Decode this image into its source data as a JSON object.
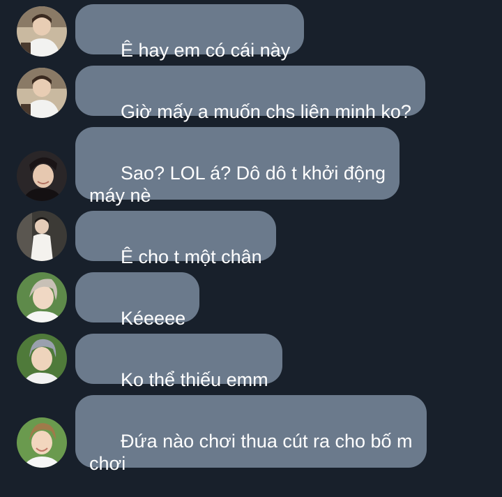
{
  "messages": [
    {
      "text": "Ê hay em có cái này",
      "avatar": "avatar-1"
    },
    {
      "text": "Giờ mấy a muốn chs liên minh ko?",
      "avatar": "avatar-1"
    },
    {
      "text": "Sao? LOL á? Dô dô t khởi động\nmáy nè",
      "avatar": "avatar-2"
    },
    {
      "text": "Ê cho t một chân",
      "avatar": "avatar-3"
    },
    {
      "text": "Kéeeee",
      "avatar": "avatar-4"
    },
    {
      "text": "Ko thể thiếu emm",
      "avatar": "avatar-5"
    },
    {
      "text": "Đứa nào chơi thua cút ra cho bố m\nchơi",
      "avatar": "avatar-6"
    }
  ],
  "colors": {
    "background": "#18202b",
    "bubble": "#6b7a8c",
    "text": "#ffffff"
  }
}
